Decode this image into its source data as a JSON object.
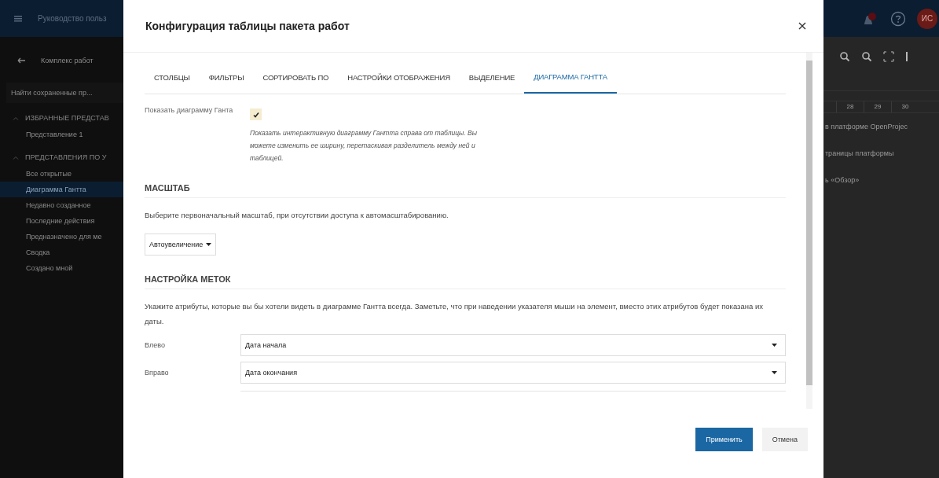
{
  "app_header": {
    "title": "Руководство польз",
    "avatar": "ИС"
  },
  "sidebar": {
    "back_label": "Комплекс работ",
    "search": {
      "placeholder": "Найти сохраненные пр..."
    },
    "sections": [
      {
        "title": "ИЗБРАННЫЕ ПРЕДСТАВ",
        "expanded": true,
        "items": [
          {
            "label": "Представление 1",
            "selected": false
          }
        ]
      },
      {
        "title": "ПРЕДСТАВЛЕНИЯ ПО У",
        "expanded": true,
        "items": [
          {
            "label": "Все открытые",
            "selected": false
          },
          {
            "label": "Диаграмма Гантта",
            "selected": true
          },
          {
            "label": "Недавно созданное",
            "selected": false
          },
          {
            "label": "Последние действия",
            "selected": false
          },
          {
            "label": "Предназначено для ме",
            "selected": false
          },
          {
            "label": "Сводка",
            "selected": false
          },
          {
            "label": "Создано мной",
            "selected": false
          }
        ]
      }
    ]
  },
  "gantt": {
    "days": [
      "28",
      "29",
      "30"
    ],
    "rows": [
      "в платформе OpenProjec",
      "траницы платформы",
      "ь «Обзор»"
    ]
  },
  "dialog": {
    "title": "Конфигурация таблицы пакета работ",
    "tabs": [
      {
        "label": "СТОЛБЦЫ",
        "selected": false
      },
      {
        "label": "ФИЛЬТРЫ",
        "selected": false
      },
      {
        "label": "СОРТИРОВАТЬ ПО",
        "selected": false
      },
      {
        "label": "НАСТРОЙКИ ОТОБРАЖЕНИЯ",
        "selected": false
      },
      {
        "label": "ВЫДЕЛЕНИЕ",
        "selected": false
      },
      {
        "label": "ДИАГРАММА ГАНТТА",
        "selected": true
      }
    ],
    "show_gantt": {
      "label": "Показать диаграмму Ганта",
      "checked": true,
      "help": "Показать интерактивную диаграмму Гантта справа от таблицы. Вы можете изменить ее ширину, перетаскивая разделитель между ней и таблицей."
    },
    "scale": {
      "heading": "МАСШТАБ",
      "description": "Выберите первоначальный масштаб, при отсутствии доступа к автомасштабированию.",
      "value": "Автоувеличение"
    },
    "labels": {
      "heading": "НАСТРОЙКА МЕТОК",
      "description": "Укажите атрибуты, которые вы бы хотели видеть в диаграмме Гантта всегда. Заметьте, что при наведении указателя мыши на элемент, вместо этих атрибутов будет показана их даты.",
      "fields": [
        {
          "label": "Влево",
          "value": "Дата начала"
        },
        {
          "label": "Вправо",
          "value": "Дата окончания"
        }
      ]
    },
    "buttons": [
      {
        "label": "Применить",
        "kind": "primary"
      },
      {
        "label": "Отмена",
        "kind": "secondary"
      }
    ]
  }
}
